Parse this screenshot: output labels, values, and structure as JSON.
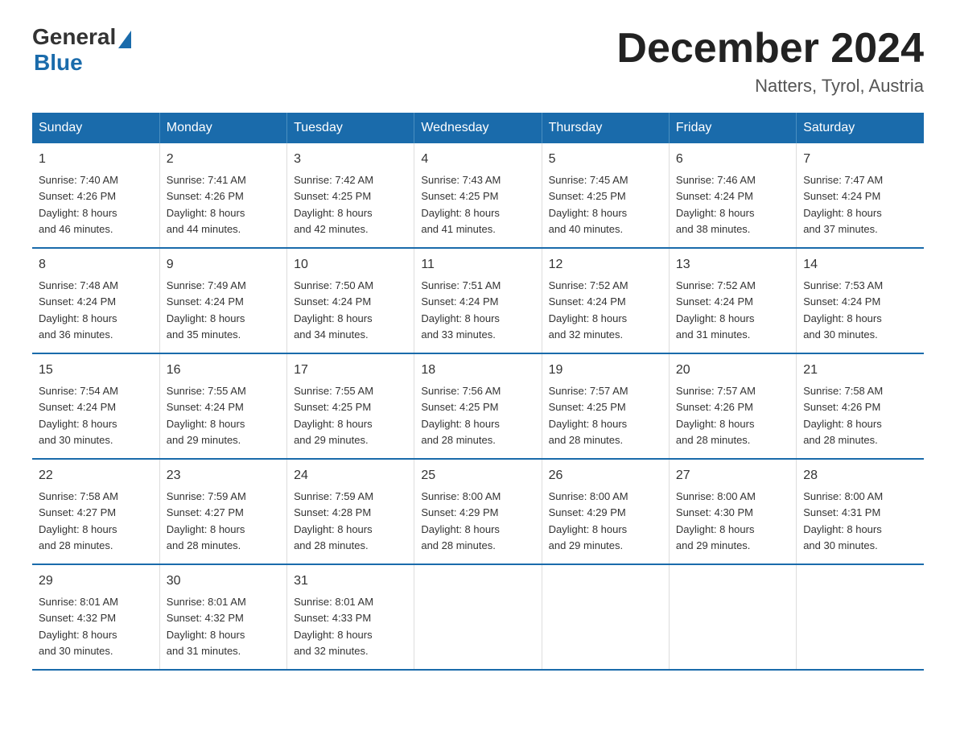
{
  "logo": {
    "general": "General",
    "blue": "Blue"
  },
  "title": "December 2024",
  "location": "Natters, Tyrol, Austria",
  "days_of_week": [
    "Sunday",
    "Monday",
    "Tuesday",
    "Wednesday",
    "Thursday",
    "Friday",
    "Saturday"
  ],
  "weeks": [
    [
      {
        "day": "1",
        "sunrise": "7:40 AM",
        "sunset": "4:26 PM",
        "daylight": "8 hours and 46 minutes."
      },
      {
        "day": "2",
        "sunrise": "7:41 AM",
        "sunset": "4:26 PM",
        "daylight": "8 hours and 44 minutes."
      },
      {
        "day": "3",
        "sunrise": "7:42 AM",
        "sunset": "4:25 PM",
        "daylight": "8 hours and 42 minutes."
      },
      {
        "day": "4",
        "sunrise": "7:43 AM",
        "sunset": "4:25 PM",
        "daylight": "8 hours and 41 minutes."
      },
      {
        "day": "5",
        "sunrise": "7:45 AM",
        "sunset": "4:25 PM",
        "daylight": "8 hours and 40 minutes."
      },
      {
        "day": "6",
        "sunrise": "7:46 AM",
        "sunset": "4:24 PM",
        "daylight": "8 hours and 38 minutes."
      },
      {
        "day": "7",
        "sunrise": "7:47 AM",
        "sunset": "4:24 PM",
        "daylight": "8 hours and 37 minutes."
      }
    ],
    [
      {
        "day": "8",
        "sunrise": "7:48 AM",
        "sunset": "4:24 PM",
        "daylight": "8 hours and 36 minutes."
      },
      {
        "day": "9",
        "sunrise": "7:49 AM",
        "sunset": "4:24 PM",
        "daylight": "8 hours and 35 minutes."
      },
      {
        "day": "10",
        "sunrise": "7:50 AM",
        "sunset": "4:24 PM",
        "daylight": "8 hours and 34 minutes."
      },
      {
        "day": "11",
        "sunrise": "7:51 AM",
        "sunset": "4:24 PM",
        "daylight": "8 hours and 33 minutes."
      },
      {
        "day": "12",
        "sunrise": "7:52 AM",
        "sunset": "4:24 PM",
        "daylight": "8 hours and 32 minutes."
      },
      {
        "day": "13",
        "sunrise": "7:52 AM",
        "sunset": "4:24 PM",
        "daylight": "8 hours and 31 minutes."
      },
      {
        "day": "14",
        "sunrise": "7:53 AM",
        "sunset": "4:24 PM",
        "daylight": "8 hours and 30 minutes."
      }
    ],
    [
      {
        "day": "15",
        "sunrise": "7:54 AM",
        "sunset": "4:24 PM",
        "daylight": "8 hours and 30 minutes."
      },
      {
        "day": "16",
        "sunrise": "7:55 AM",
        "sunset": "4:24 PM",
        "daylight": "8 hours and 29 minutes."
      },
      {
        "day": "17",
        "sunrise": "7:55 AM",
        "sunset": "4:25 PM",
        "daylight": "8 hours and 29 minutes."
      },
      {
        "day": "18",
        "sunrise": "7:56 AM",
        "sunset": "4:25 PM",
        "daylight": "8 hours and 28 minutes."
      },
      {
        "day": "19",
        "sunrise": "7:57 AM",
        "sunset": "4:25 PM",
        "daylight": "8 hours and 28 minutes."
      },
      {
        "day": "20",
        "sunrise": "7:57 AM",
        "sunset": "4:26 PM",
        "daylight": "8 hours and 28 minutes."
      },
      {
        "day": "21",
        "sunrise": "7:58 AM",
        "sunset": "4:26 PM",
        "daylight": "8 hours and 28 minutes."
      }
    ],
    [
      {
        "day": "22",
        "sunrise": "7:58 AM",
        "sunset": "4:27 PM",
        "daylight": "8 hours and 28 minutes."
      },
      {
        "day": "23",
        "sunrise": "7:59 AM",
        "sunset": "4:27 PM",
        "daylight": "8 hours and 28 minutes."
      },
      {
        "day": "24",
        "sunrise": "7:59 AM",
        "sunset": "4:28 PM",
        "daylight": "8 hours and 28 minutes."
      },
      {
        "day": "25",
        "sunrise": "8:00 AM",
        "sunset": "4:29 PM",
        "daylight": "8 hours and 28 minutes."
      },
      {
        "day": "26",
        "sunrise": "8:00 AM",
        "sunset": "4:29 PM",
        "daylight": "8 hours and 29 minutes."
      },
      {
        "day": "27",
        "sunrise": "8:00 AM",
        "sunset": "4:30 PM",
        "daylight": "8 hours and 29 minutes."
      },
      {
        "day": "28",
        "sunrise": "8:00 AM",
        "sunset": "4:31 PM",
        "daylight": "8 hours and 30 minutes."
      }
    ],
    [
      {
        "day": "29",
        "sunrise": "8:01 AM",
        "sunset": "4:32 PM",
        "daylight": "8 hours and 30 minutes."
      },
      {
        "day": "30",
        "sunrise": "8:01 AM",
        "sunset": "4:32 PM",
        "daylight": "8 hours and 31 minutes."
      },
      {
        "day": "31",
        "sunrise": "8:01 AM",
        "sunset": "4:33 PM",
        "daylight": "8 hours and 32 minutes."
      },
      null,
      null,
      null,
      null
    ]
  ],
  "labels": {
    "sunrise_prefix": "Sunrise: ",
    "sunset_prefix": "Sunset: ",
    "daylight_prefix": "Daylight: "
  }
}
